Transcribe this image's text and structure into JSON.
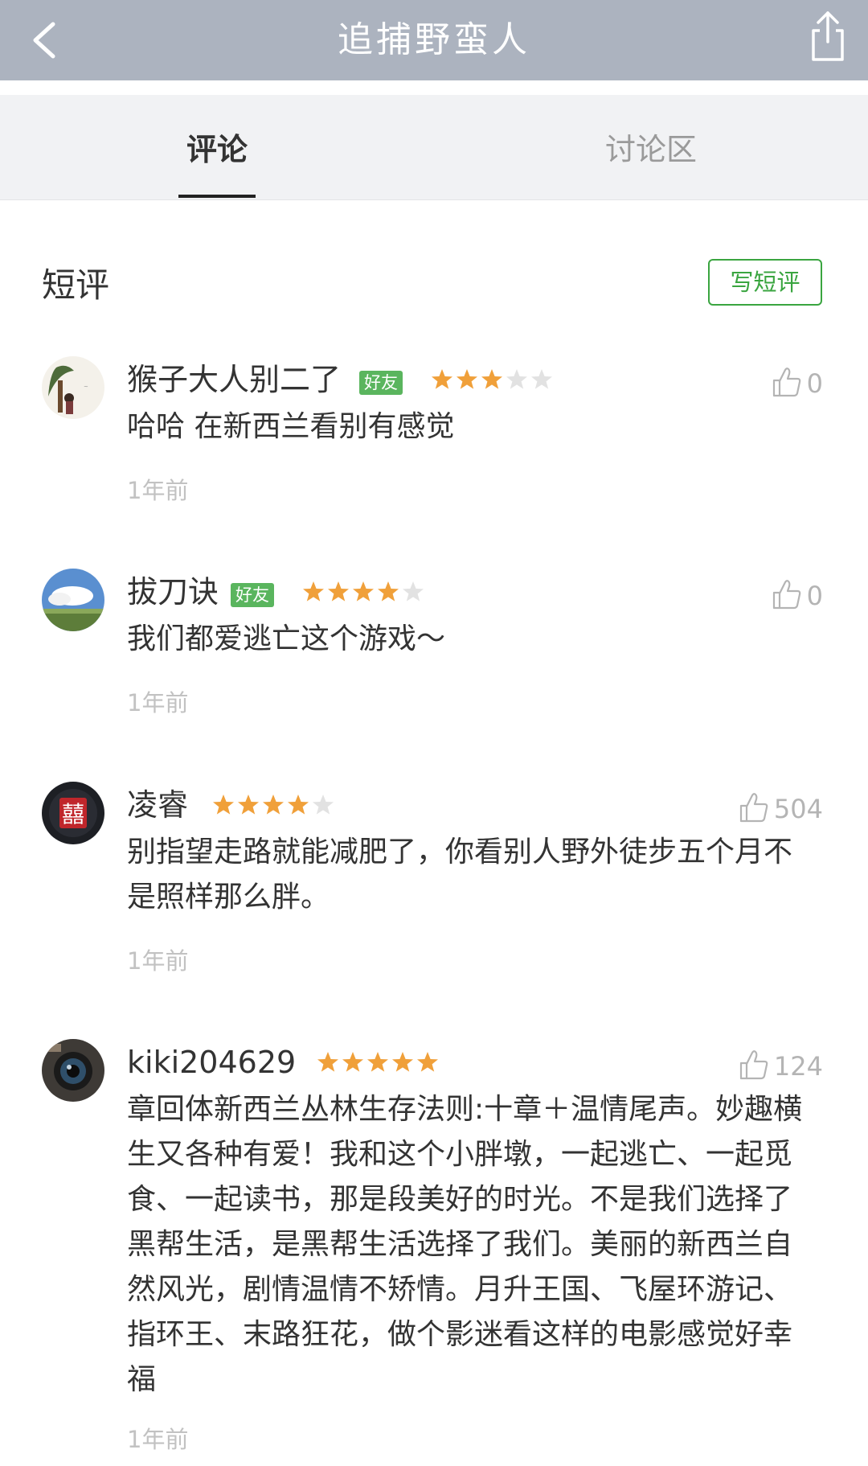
{
  "nav": {
    "title": "追捕野蛮人",
    "back_icon": "back-chevron-icon",
    "share_icon": "share-icon",
    "bar_color": "#acb3bf"
  },
  "tabs": [
    {
      "label": "评论",
      "active": true
    },
    {
      "label": "讨论区",
      "active": false
    }
  ],
  "section": {
    "title": "短评",
    "write_button": "写短评",
    "accent_color": "#3aa540"
  },
  "comments": [
    {
      "author": "猴子大人别二了",
      "friend_badge": "好友",
      "rating": 3,
      "likes": "0",
      "text": "哈哈 在新西兰看别有感觉",
      "time": "1年前"
    },
    {
      "author": "拔刀诀",
      "friend_badge": "好友",
      "rating": 4,
      "likes": "0",
      "text": "我们都爱逃亡这个游戏～",
      "time": "1年前"
    },
    {
      "author": "凌睿",
      "friend_badge": "",
      "rating": 4,
      "likes": "504",
      "text": "别指望走路就能减肥了，你看别人野外徒步五个月不是照样那么胖。",
      "time": "1年前"
    },
    {
      "author": "kiki204629",
      "friend_badge": "",
      "rating": 5,
      "likes": "124",
      "text": "章回体新西兰丛林生存法则:十章＋温情尾声。妙趣横生又各种有爱！我和这个小胖墩，一起逃亡、一起觅食、一起读书，那是段美好的时光。不是我们选择了黑帮生活，是黑帮生活选择了我们。美丽的新西兰自然风光，剧情温情不矫情。月升王国、飞屋环游记、指环王、末路狂花，做个影迷看这样的电影感觉好幸福",
      "time": "1年前"
    }
  ],
  "star_colors": {
    "filled": "#f0a03a",
    "empty": "#e2e2e2"
  }
}
